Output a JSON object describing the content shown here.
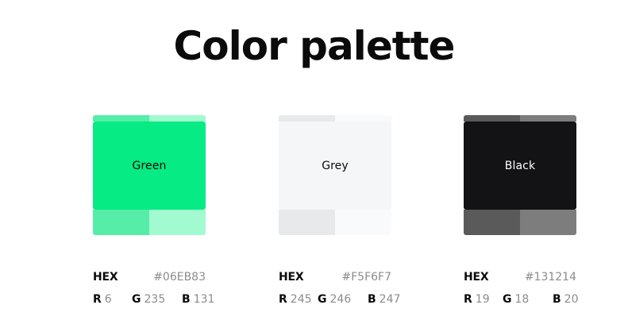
{
  "page": {
    "title": "Color palette"
  },
  "colors": [
    {
      "name": "Green",
      "main_color": "#06EB83",
      "text_color": "#0b0b0b",
      "tint_top_left": "#55EDA8",
      "tint_top_right": "#A2FAD0",
      "tint_bottom_left": "#55EDA8",
      "tint_bottom_right": "#A2FAD0",
      "hex_label": "HEX",
      "hex": "#06EB83",
      "r_label": "R",
      "r": "6",
      "g_label": "G",
      "g": "235",
      "b_label": "B",
      "b": "131"
    },
    {
      "name": "Grey",
      "main_color": "#F5F6F7",
      "text_color": "#0b0b0b",
      "tint_top_left": "#E8E9EA",
      "tint_top_right": "#F9FAFB",
      "tint_bottom_left": "#E8E9EA",
      "tint_bottom_right": "#F9FAFB",
      "hex_label": "HEX",
      "hex": "#F5F6F7",
      "r_label": "R",
      "r": "245",
      "g_label": "G",
      "g": "246",
      "b_label": "B",
      "b": "247"
    },
    {
      "name": "Black",
      "main_color": "#131214",
      "text_color": "#ffffff",
      "tint_top_left": "#5A5A5A",
      "tint_top_right": "#7E7D7E",
      "tint_bottom_left": "#5A5A5A",
      "tint_bottom_right": "#7E7D7E",
      "hex_label": "HEX",
      "hex": "#131214",
      "r_label": "R",
      "r": "19",
      "g_label": "G",
      "g": "18",
      "b_label": "B",
      "b": "20"
    }
  ]
}
